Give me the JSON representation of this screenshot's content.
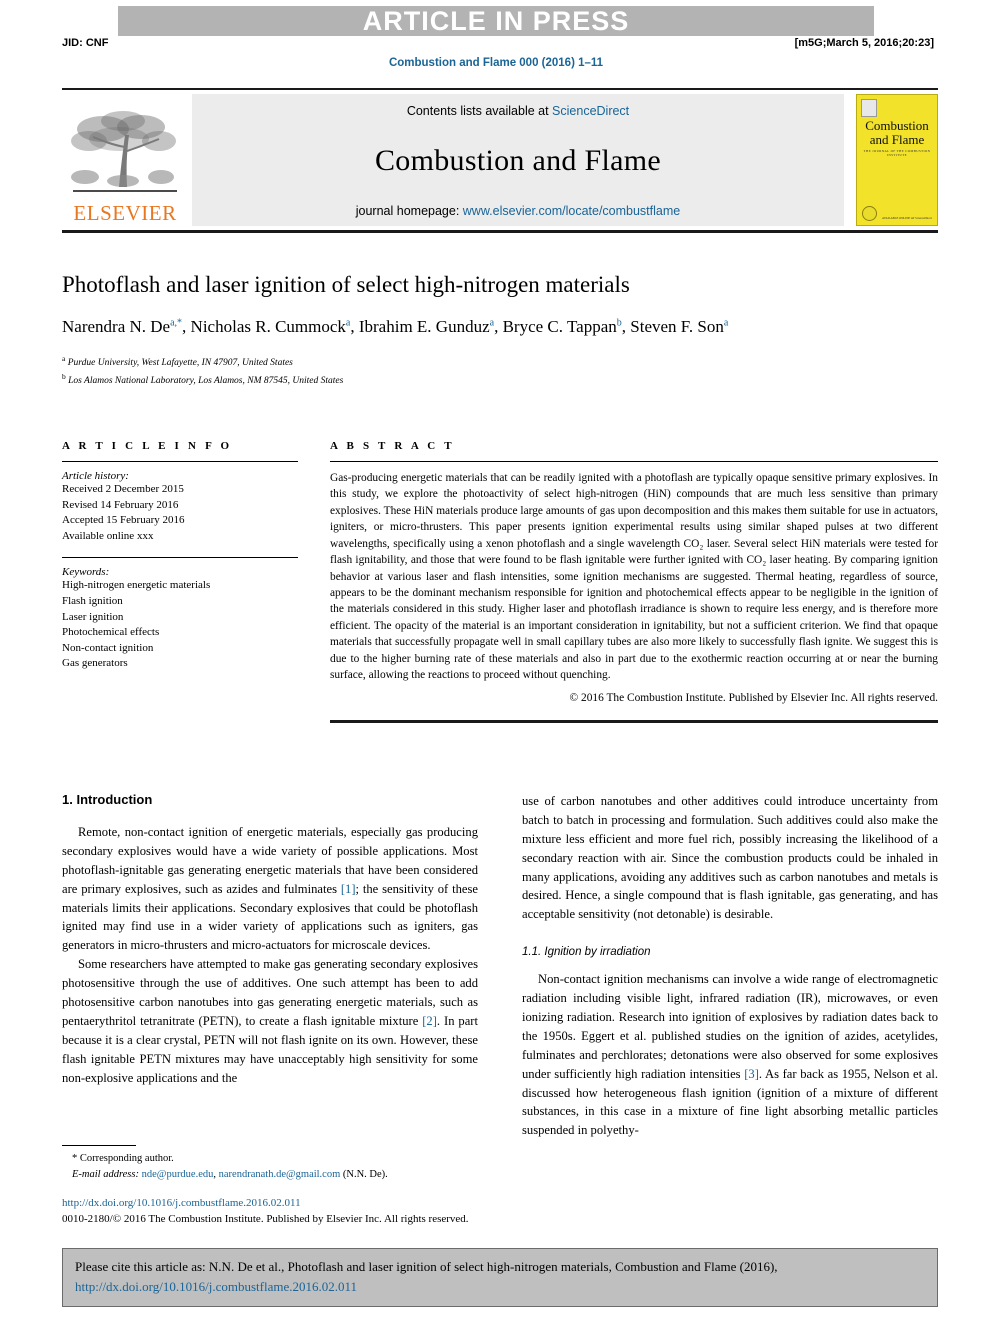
{
  "banner": {
    "text": "ARTICLE IN PRESS",
    "jid": "JID: CNF",
    "stamp": "[m5G;March 5, 2016;20:23]",
    "journal_ref": "Combustion and Flame 000 (2016) 1–11"
  },
  "masthead": {
    "contents_prefix": "Contents lists available at ",
    "sciencedirect": "ScienceDirect",
    "journal_title": "Combustion and Flame",
    "homepage_prefix": "journal homepage: ",
    "homepage_url": "www.elsevier.com/locate/combustflame",
    "publisher_logo_text": "ELSEVIER",
    "cover": {
      "title_line1": "Combustion",
      "title_line2": "and Flame",
      "subtitle": "THE JOURNAL OF THE COMBUSTION INSTITUTE",
      "bottom_text": "AVAILABLE ONLINE AT\nScienceDirect"
    }
  },
  "article": {
    "title": "Photoflash and laser ignition of select high-nitrogen materials",
    "authors": [
      {
        "name": "Narendra N. De",
        "sup": "a,*"
      },
      {
        "name": "Nicholas R. Cummock",
        "sup": "a"
      },
      {
        "name": "Ibrahim E. Gunduz",
        "sup": "a"
      },
      {
        "name": "Bryce C. Tappan",
        "sup": "b"
      },
      {
        "name": "Steven F. Son",
        "sup": "a"
      }
    ],
    "affiliations": [
      {
        "marker": "a",
        "text": "Purdue University, West Lafayette, IN 47907, United States"
      },
      {
        "marker": "b",
        "text": "Los Alamos National Laboratory, Los Alamos, NM 87545, United States"
      }
    ]
  },
  "info": {
    "heading": "A R T I C L E   I N F O",
    "history_label": "Article history:",
    "history": [
      "Received 2 December 2015",
      "Revised 14 February 2016",
      "Accepted 15 February 2016",
      "Available online xxx"
    ],
    "keywords_label": "Keywords:",
    "keywords": [
      "High-nitrogen energetic materials",
      "Flash ignition",
      "Laser ignition",
      "Photochemical effects",
      "Non-contact ignition",
      "Gas generators"
    ]
  },
  "abstract": {
    "heading": "A B S T R A C T",
    "body": "Gas-producing energetic materials that can be readily ignited with a photoflash are typically opaque sensitive primary explosives. In this study, we explore the photoactivity of select high-nitrogen (HiN) compounds that are much less sensitive than primary explosives. These HiN materials produce large amounts of gas upon decomposition and this makes them suitable for use in actuators, igniters, or micro-thrusters. This paper presents ignition experimental results using similar shaped pulses at two different wavelengths, specifically using a xenon photoflash and a single wavelength CO₂ laser. Several select HiN materials were tested for flash ignitability, and those that were found to be flash ignitable were further ignited with CO₂ laser heating. By comparing ignition behavior at various laser and flash intensities, some ignition mechanisms are suggested. Thermal heating, regardless of source, appears to be the dominant mechanism responsible for ignition and photochemical effects appear to be negligible in the ignition of the materials considered in this study. Higher laser and photoflash irradiance is shown to require less energy, and is therefore more efficient. The opacity of the material is an important consideration in ignitability, but not a sufficient criterion. We find that opaque materials that successfully propagate well in small capillary tubes are also more likely to successfully flash ignite. We suggest this is due to the higher burning rate of these materials and also in part due to the exothermic reaction occurring at or near the burning surface, allowing the reactions to proceed without quenching.",
    "copyright": "© 2016 The Combustion Institute. Published by Elsevier Inc. All rights reserved."
  },
  "body": {
    "section1_heading": "1. Introduction",
    "left_paragraphs": [
      {
        "pre": "Remote, non-contact ignition of energetic materials, especially gas producing secondary explosives would have a wide variety of possible applications. Most photoflash-ignitable gas generating energetic materials that have been considered are primary explosives, such as azides and fulminates ",
        "ref": "[1]",
        "post": "; the sensitivity of these materials limits their applications. Secondary explosives that could be photoflash ignited may find use in a wider variety of applications such as igniters, gas generators in micro-thrusters and micro-actuators for microscale devices."
      },
      {
        "pre": "Some researchers have attempted to make gas generating secondary explosives photosensitive through the use of additives. One such attempt has been to add photosensitive carbon nanotubes into gas generating energetic materials, such as pentaerythritol tetranitrate (PETN), to create a flash ignitable mixture ",
        "ref": "[2]",
        "post": ". In part because it is a clear crystal, PETN will not flash ignite on its own. However, these flash ignitable PETN mixtures may have unacceptably high sensitivity for some non-explosive applications and the"
      }
    ],
    "right_paragraph_top": "use of carbon nanotubes and other additives could introduce uncertainty from batch to batch in processing and formulation. Such additives could also make the mixture less efficient and more fuel rich, possibly increasing the likelihood of a secondary reaction with air. Since the combustion products could be inhaled in many applications, avoiding any additives such as carbon nanotubes and metals is desired. Hence, a single compound that is flash ignitable, gas generating, and has acceptable sensitivity (not detonable) is desirable.",
    "subsection_heading": "1.1. Ignition by irradiation",
    "right_paragraph_bottom": {
      "pre": "Non-contact ignition mechanisms can involve a wide range of electromagnetic radiation including visible light, infrared radiation (IR), microwaves, or even ionizing radiation. Research into ignition of explosives by radiation dates back to the 1950s. Eggert et al. published studies on the ignition of azides, acetylides, fulminates and perchlorates; detonations were also observed for some explosives under sufficiently high radiation intensities ",
      "ref": "[3]",
      "post": ". As far back as 1955, Nelson et al. discussed how heterogeneous flash ignition (ignition of a mixture of different substances, in this case in a mixture of fine light absorbing metallic particles suspended in polyethy-"
    }
  },
  "footnote": {
    "corresponding": "* Corresponding author.",
    "email_label": "E-mail address:",
    "email1": "nde@purdue.edu",
    "email_sep": ", ",
    "email2": "narendranath.de@gmail.com",
    "email_suffix": " (N.N. De)."
  },
  "doi_block": {
    "doi": "http://dx.doi.org/10.1016/j.combustflame.2016.02.011",
    "issn": "0010-2180/© 2016 The Combustion Institute. Published by Elsevier Inc. All rights reserved."
  },
  "cite_box": {
    "line1": "Please cite this article as: N.N. De et al., Photoflash and laser ignition of select high-nitrogen materials, Combustion and Flame (2016),",
    "line2": "http://dx.doi.org/10.1016/j.combustflame.2016.02.011"
  },
  "colors": {
    "link": "#1a6496",
    "banner_bg": "#b3b3b3",
    "cover_yellow": "#f2e22a",
    "elsevier_orange": "#e87722",
    "cite_box_bg": "#bfbfbf"
  }
}
